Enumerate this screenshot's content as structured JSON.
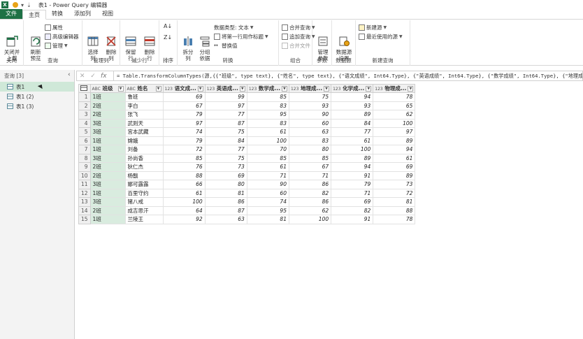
{
  "window": {
    "title": "表1 - Power Query 编辑器",
    "app_icon": "X"
  },
  "tabs": [
    {
      "label": "文件"
    },
    {
      "label": "主页"
    },
    {
      "label": "转换"
    },
    {
      "label": "添加列"
    },
    {
      "label": "视图"
    }
  ],
  "ribbon": {
    "close_group": {
      "btn": "关闭并\n上载",
      "label": "关闭"
    },
    "query_group": {
      "refresh": "刷新\n预览",
      "properties": "属性",
      "advanced": "高级编辑器",
      "manage": "管理",
      "label": "查询"
    },
    "cols_group": {
      "choose": "选择\n列",
      "remove": "删除\n列",
      "label": "管理列"
    },
    "rows_group": {
      "keep": "保留\n行",
      "remove": "删除\n行",
      "label": "减少行"
    },
    "sort_group": {
      "label": "排序"
    },
    "transform_group": {
      "split": "拆分\n列",
      "group": "分组\n依据",
      "datatype": "数据类型: 文本",
      "first_row": "将第一行用作标题",
      "replace": "替换值",
      "label": "转换"
    },
    "combine_group": {
      "merge": "合并查询",
      "append": "追加查询",
      "merge_files": "合并文件",
      "label": "组合"
    },
    "params_group": {
      "manage": "管理\n参数",
      "label": "参数"
    },
    "datasource_group": {
      "settings": "数据源\n设置",
      "label": "数据源"
    },
    "newquery_group": {
      "new_source": "新建源",
      "recent": "最近使用的源",
      "label": "新建查询"
    }
  },
  "formula": "= Table.TransformColumnTypes(源,{{\"班级\", type text}, {\"姓名\", type text}, {\"语文成绩\", Int64.Type}, {\"英语成绩\", Int64.Type}, {\"数学成绩\", Int64.Type}, {\"地理成绩\", In",
  "queries": {
    "header": "查询 [3]",
    "items": [
      {
        "label": "表1"
      },
      {
        "label": "表1 (2)"
      },
      {
        "label": "表1 (3)"
      }
    ]
  },
  "table": {
    "columns": [
      {
        "type": "ABC",
        "name": "班级"
      },
      {
        "type": "ABC",
        "name": "姓名"
      },
      {
        "type": "123",
        "name": "语文成..."
      },
      {
        "type": "123",
        "name": "英语成..."
      },
      {
        "type": "123",
        "name": "数学成..."
      },
      {
        "type": "123",
        "name": "地理成..."
      },
      {
        "type": "123",
        "name": "化学成..."
      },
      {
        "type": "123",
        "name": "物理成..."
      }
    ],
    "rows": [
      [
        "1",
        "1班",
        "鲁班",
        "69",
        "99",
        "85",
        "75",
        "94",
        "78"
      ],
      [
        "2",
        "2班",
        "李白",
        "67",
        "97",
        "83",
        "93",
        "93",
        "65"
      ],
      [
        "3",
        "2班",
        "张飞",
        "79",
        "77",
        "95",
        "90",
        "89",
        "62"
      ],
      [
        "4",
        "3班",
        "武则天",
        "97",
        "87",
        "83",
        "60",
        "84",
        "100"
      ],
      [
        "5",
        "3班",
        "宫本武藏",
        "74",
        "75",
        "61",
        "63",
        "77",
        "97"
      ],
      [
        "6",
        "1班",
        "嫦娥",
        "79",
        "84",
        "100",
        "83",
        "61",
        "89"
      ],
      [
        "7",
        "1班",
        "刘备",
        "72",
        "77",
        "70",
        "80",
        "100",
        "94"
      ],
      [
        "8",
        "3班",
        "孙尚香",
        "85",
        "75",
        "85",
        "85",
        "89",
        "61"
      ],
      [
        "9",
        "2班",
        "狄仁杰",
        "76",
        "73",
        "61",
        "67",
        "94",
        "69"
      ],
      [
        "10",
        "2班",
        "杨戬",
        "88",
        "69",
        "71",
        "71",
        "91",
        "89"
      ],
      [
        "11",
        "3班",
        "娜可露露",
        "66",
        "80",
        "90",
        "86",
        "79",
        "73"
      ],
      [
        "12",
        "1班",
        "百里守约",
        "61",
        "81",
        "60",
        "82",
        "71",
        "72"
      ],
      [
        "13",
        "3班",
        "猪八戒",
        "100",
        "86",
        "74",
        "86",
        "69",
        "81"
      ],
      [
        "14",
        "2班",
        "成吉思汗",
        "64",
        "87",
        "95",
        "62",
        "82",
        "88"
      ],
      [
        "15",
        "1班",
        "兰陵王",
        "92",
        "63",
        "81",
        "100",
        "91",
        "78"
      ]
    ]
  },
  "colors": {
    "accent": "#1e7145",
    "selected_col": "#d9ecdf"
  }
}
